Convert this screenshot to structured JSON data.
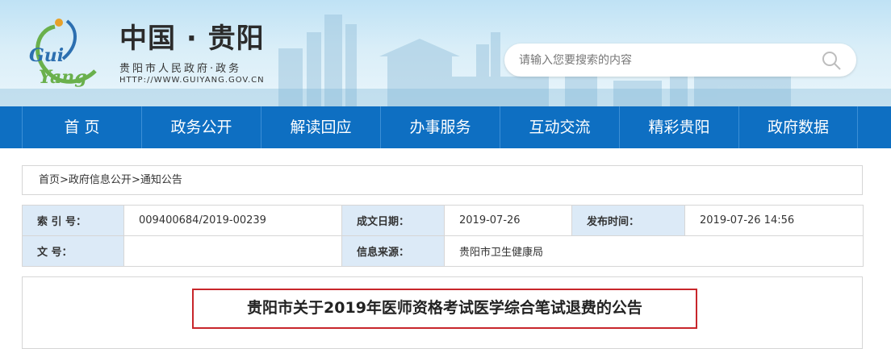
{
  "header": {
    "site_title": "中国 · 贵阳",
    "site_subtitle": "贵阳市人民政府·政务",
    "site_url": "HTTP://WWW.GUIYANG.GOV.CN",
    "logo_text": "GuiYang"
  },
  "search": {
    "placeholder": "请输入您要搜索的内容"
  },
  "nav": {
    "items": [
      "首 页",
      "政务公开",
      "解读回应",
      "办事服务",
      "互动交流",
      "精彩贵阳",
      "政府数据"
    ]
  },
  "breadcrumb": {
    "items": [
      "首页",
      "政府信息公开",
      "通知公告"
    ],
    "separator": ">"
  },
  "info": {
    "index_label": "索 引 号：",
    "index_value": "009400684/2019-00239",
    "created_label": "成文日期：",
    "created_value": "2019-07-26",
    "published_label": "发布时间：",
    "published_value": "2019-07-26 14:56",
    "doc_no_label": "文 号：",
    "doc_no_value": "",
    "source_label": "信息来源：",
    "source_value": "贵阳市卫生健康局"
  },
  "article": {
    "title": "贵阳市关于2019年医师资格考试医学综合笔试退费的公告"
  },
  "colors": {
    "nav_bg": "#0e6fc2",
    "label_bg": "#dceaf7",
    "title_border": "#c8262b"
  }
}
